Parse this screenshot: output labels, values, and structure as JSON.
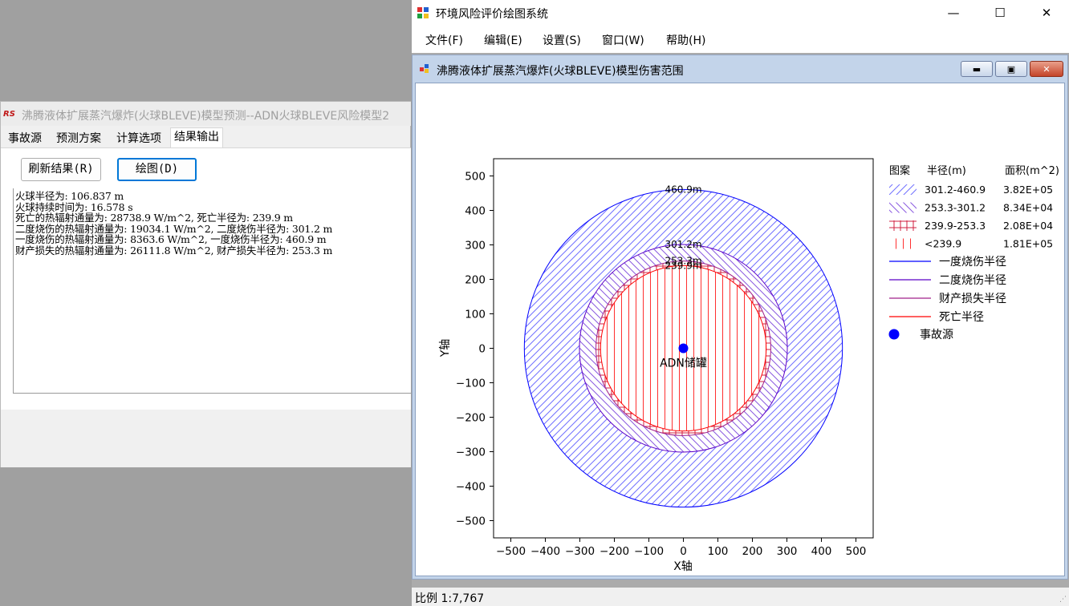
{
  "left_window": {
    "title": "沸腾液体扩展蒸汽爆炸(火球BLEVE)模型预测--ADN火球BLEVE风险模型2",
    "tabs": [
      "事故源",
      "预测方案",
      "计算选项",
      "结果输出"
    ],
    "active_tab": "结果输出",
    "refresh_button": "刷新结果(R)",
    "plot_button": "绘图(D)",
    "output_lines": [
      "火球半径为: 106.837 m",
      "火球持续时间为: 16.578 s",
      "死亡的热辐射通量为: 28738.9 W/m^2, 死亡半径为: 239.9 m",
      "二度烧伤的热辐射通量为: 19034.1 W/m^2, 二度烧伤半径为: 301.2 m",
      "一度烧伤的热辐射通量为: 8363.6 W/m^2, 一度烧伤半径为: 460.9 m",
      "财产损失的热辐射通量为: 26111.8 W/m^2, 财产损失半径为: 253.3 m"
    ]
  },
  "main_window": {
    "title": "环境风险评价绘图系统",
    "controls": {
      "minimize": "—",
      "maximize": "☐",
      "close": "✕"
    },
    "menu": [
      "文件(F)",
      "编辑(E)",
      "设置(S)",
      "窗口(W)",
      "帮助(H)"
    ],
    "child_window_title": "沸腾液体扩展蒸汽爆炸(火球BLEVE)模型伤害范围",
    "status": "比例 1:7,767"
  },
  "chart_data": {
    "type": "scatter",
    "xlabel": "X轴",
    "ylabel": "Y轴",
    "xlim": [
      -550,
      550
    ],
    "ylim": [
      -550,
      550
    ],
    "xticks": [
      -500,
      -400,
      -300,
      -200,
      -100,
      0,
      100,
      200,
      300,
      400,
      500
    ],
    "yticks": [
      -500,
      -400,
      -300,
      -200,
      -100,
      0,
      100,
      200,
      300,
      400,
      500
    ],
    "circles": [
      {
        "name": "一度烧伤半径",
        "radius": 460.9,
        "label": "460.9m",
        "color": "#0000ff",
        "hatch": "diag-right"
      },
      {
        "name": "二度烧伤半径",
        "radius": 301.2,
        "label": "301.2m",
        "color": "#5b00c8",
        "hatch": "diag-left"
      },
      {
        "name": "财产损失半径",
        "radius": 253.3,
        "label": "253.3m",
        "color": "#a0208a",
        "hatch": "grid"
      },
      {
        "name": "死亡半径",
        "radius": 239.9,
        "label": "239.9m",
        "color": "#ff0000",
        "hatch": "vertical"
      }
    ],
    "source": {
      "name": "事故源",
      "x": 0,
      "y": 0,
      "label": "ADN储罐",
      "color": "#0000ff"
    },
    "legend": {
      "position": "right",
      "headers": [
        "图案",
        "半径(m)",
        "面积(m^2)"
      ],
      "rows": [
        {
          "range": "301.2-460.9",
          "area": "3.82E+05",
          "hatch": "diag-right",
          "color": "#0000ff"
        },
        {
          "range": "253.3-301.2",
          "area": "8.34E+04",
          "hatch": "diag-left",
          "color": "#5b00c8"
        },
        {
          "range": "239.9-253.3",
          "area": "2.08E+04",
          "hatch": "grid",
          "color": "#d02040"
        },
        {
          "range": "<239.9",
          "area": "1.81E+05",
          "hatch": "vertical",
          "color": "#ff0000"
        }
      ],
      "lines": [
        {
          "label": "一度烧伤半径",
          "color": "#0000ff"
        },
        {
          "label": "二度烧伤半径",
          "color": "#5b00c8"
        },
        {
          "label": "财产损失半径",
          "color": "#a0208a"
        },
        {
          "label": "死亡半径",
          "color": "#ff0000"
        }
      ],
      "marker": {
        "label": "事故源",
        "color": "#0000ff"
      }
    }
  }
}
